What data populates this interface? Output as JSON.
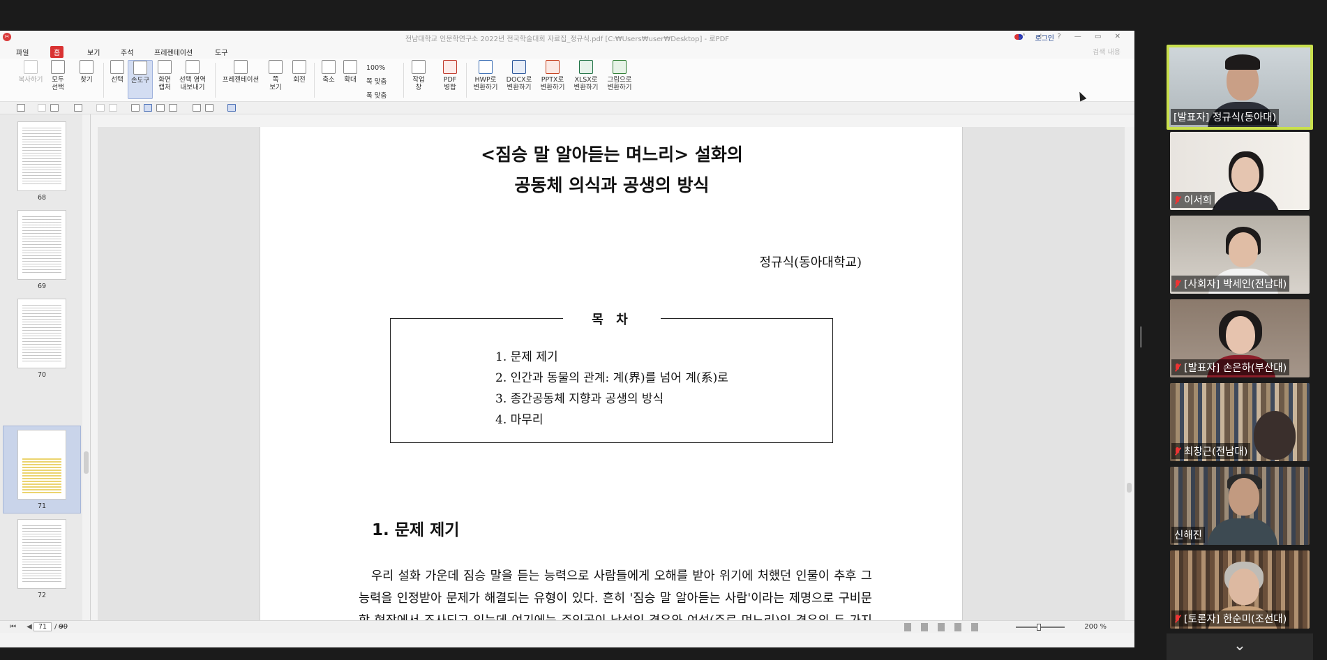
{
  "app": {
    "window_title": "전남대학교 인문학연구소 2022년 전국학술대회 자료집_정규식.pdf [C:₩Users₩user₩Desktop] - 로PDF",
    "login_label": "로그인",
    "window_controls": "⤢ ⊹ ? — ▭ ✕",
    "menu": [
      "파일",
      "홈",
      "보기",
      "주석",
      "프레젠테이션",
      "도구"
    ],
    "menu_active": "홈",
    "menu_right": "검색 내용"
  },
  "ribbon": {
    "buttons": [
      {
        "label": "복사하기",
        "icon": "copy-icon"
      },
      {
        "label": "모두\n선택",
        "icon": "select-all-icon"
      },
      {
        "label": "찾기",
        "icon": "binoculars-icon"
      },
      {
        "label": "선택",
        "icon": "select-cursor-icon"
      },
      {
        "label": "손도구",
        "icon": "hand-tool-icon"
      },
      {
        "label": "화면\n캡처",
        "icon": "camera-icon"
      },
      {
        "label": "선택 영역\n내보내기",
        "icon": "export-area-icon"
      },
      {
        "label": "프레젠테이션",
        "icon": "presentation-icon"
      },
      {
        "label": "쪽\n보기",
        "icon": "page-view-icon"
      },
      {
        "label": "회전",
        "icon": "rotate-icon"
      },
      {
        "label": "축소",
        "icon": "zoom-out-icon"
      },
      {
        "label": "확대",
        "icon": "zoom-in-icon"
      },
      {
        "label": "작업\n창",
        "icon": "task-pane-icon"
      },
      {
        "label": "PDF\n병합",
        "icon": "pdf-merge-icon"
      },
      {
        "label": "HWP로\n변환하기",
        "icon": "hwp-convert-icon"
      },
      {
        "label": "DOCX로\n변환하기",
        "icon": "docx-convert-icon"
      },
      {
        "label": "PPTX로\n변환하기",
        "icon": "pptx-convert-icon"
      },
      {
        "label": "XLSX로\n변환하기",
        "icon": "xlsx-convert-icon"
      },
      {
        "label": "그림으로\n변환하기",
        "icon": "image-convert-icon"
      }
    ],
    "zoom_options": [
      "100%",
      "쪽 맞춤",
      "폭 맞춤"
    ]
  },
  "thumbnails": [
    {
      "page": "68"
    },
    {
      "page": "69"
    },
    {
      "page": "70"
    },
    {
      "page": "71"
    },
    {
      "page": "72"
    }
  ],
  "document": {
    "title_line1": "<짐승 말 알아듣는 며느리> 설화의",
    "title_line2": "공동체 의식과 공생의 방식",
    "author": "정규식(동아대학교)",
    "toc_heading": "목 차",
    "toc": [
      "1. 문제 제기",
      "2. 인간과 동물의 관계: 계(界)를 넘어 계(系)로",
      "3. 종간공동체 지향과 공생의 방식",
      "4. 마무리"
    ],
    "section_heading": "1. 문제 제기",
    "paragraph": "우리 설화 가운데 짐승 말을 듣는 능력으로 사람들에게 오해를 받아 위기에 처했던 인물이 추후 그 능력을 인정받아 문제가 해결되는 유형이 있다. 흔히 '짐승 말 알아듣는 사람'이라는 제명으로 구비문학 현장에서 조사되고 있는데 여기에는 주인공이 남성인 경우와 여성(주로 며느리)인 경우의 두 가지 하위 유"
  },
  "status": {
    "current_page": "71",
    "total_pages": "/ 99",
    "zoom": "200 %",
    "nav": "⏮ ◀ ▶ ⏭"
  },
  "participants": [
    {
      "name": "[발표자] 정규식(동아대)",
      "muted": false,
      "active": true
    },
    {
      "name": "이서희",
      "muted": true,
      "active": false
    },
    {
      "name": "[사회자] 박세인(전남대)",
      "muted": true,
      "active": false
    },
    {
      "name": "[발표자] 손은하(부산대)",
      "muted": true,
      "active": false
    },
    {
      "name": "최창근(전남대)",
      "muted": true,
      "active": false
    },
    {
      "name": "신해진",
      "muted": false,
      "active": false
    },
    {
      "name": "[토론자] 한순미(조선대)",
      "muted": true,
      "active": false
    }
  ],
  "colors": {
    "accent_red": "#d93232",
    "active_speaker_border": "#c9e04d",
    "selection_blue": "#c9d4ea"
  },
  "chevron": "⌄"
}
